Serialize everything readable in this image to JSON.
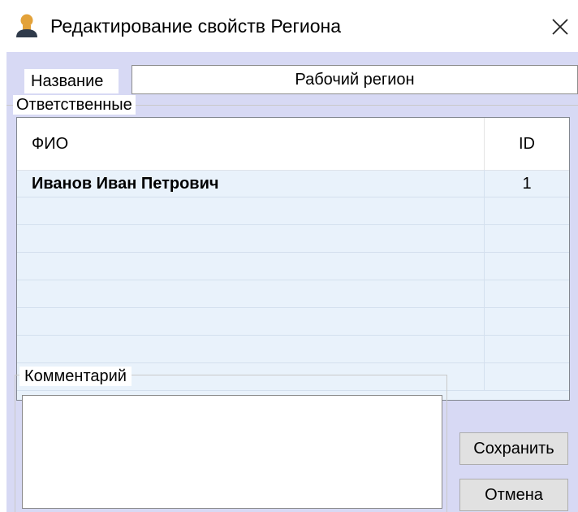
{
  "window": {
    "title": "Редактирование свойств Региона",
    "icon": "user-icon",
    "close_icon": "close-icon"
  },
  "name_field": {
    "label": "Название",
    "value": "Рабочий регион"
  },
  "responsible": {
    "group_label": "Ответственные",
    "columns": [
      "ФИО",
      "ID"
    ],
    "rows": [
      {
        "fio": "Иванов Иван Петрович",
        "id": "1"
      }
    ]
  },
  "comment": {
    "group_label": "Комментарий",
    "value": ""
  },
  "buttons": {
    "save": "Сохранить",
    "cancel": "Отмена"
  },
  "colors": {
    "client_background": "#d7d9f4",
    "grid_background": "#e9f2fb",
    "icon_orange": "#e3a23a",
    "icon_dark": "#2f3a4a"
  }
}
